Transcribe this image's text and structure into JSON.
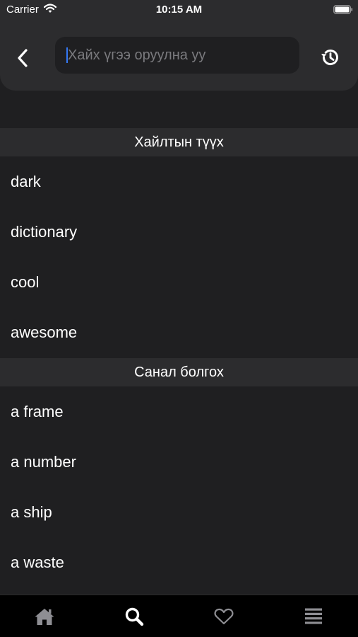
{
  "status_bar": {
    "carrier": "Carrier",
    "time": "10:15 AM"
  },
  "search": {
    "placeholder": "Хайх үгээ оруулна уу",
    "value": ""
  },
  "history_section": {
    "title": "Хайлтын түүх",
    "items": [
      "dark",
      "dictionary",
      "cool",
      "awesome"
    ]
  },
  "suggestion_section": {
    "title": "Санал болгох",
    "items": [
      "a frame",
      "a number",
      "a ship",
      "a waste"
    ]
  },
  "tab_bar": {
    "tabs": [
      {
        "icon": "home-icon",
        "active": false
      },
      {
        "icon": "search-icon",
        "active": true
      },
      {
        "icon": "heart-icon",
        "active": false
      },
      {
        "icon": "menu-icon",
        "active": false
      }
    ]
  },
  "colors": {
    "background": "#1f1f21",
    "header": "#2c2c2e",
    "tab_active": "#ffffff",
    "tab_inactive": "#8e8e93",
    "caret": "#3478f6"
  }
}
